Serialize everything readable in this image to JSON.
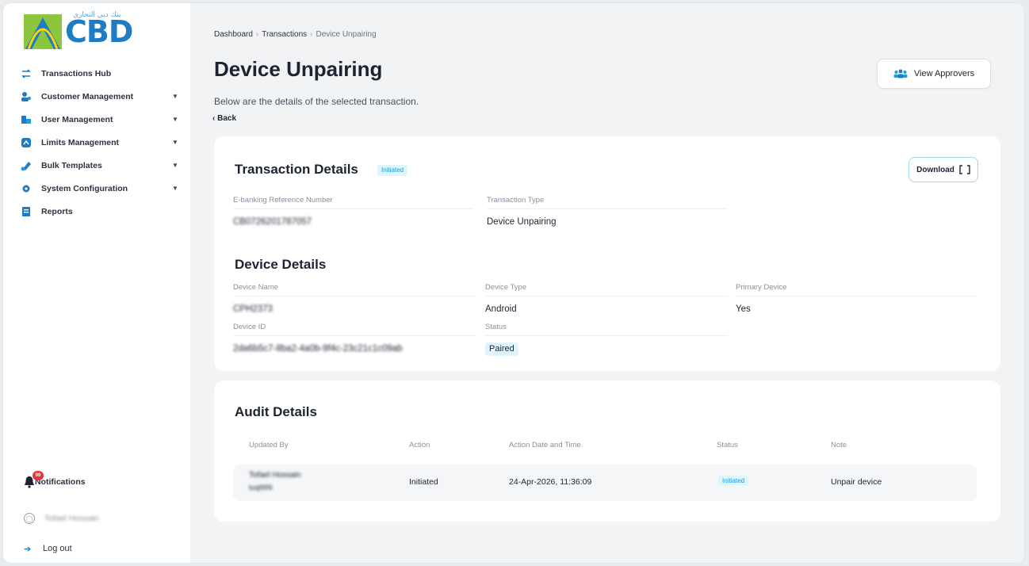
{
  "brand": {
    "arabic_text": "بنك دبي التجاري",
    "wordmark": "CBD"
  },
  "colors": {
    "brand_blue": "#1e7cc4",
    "accent_cyan": "#1a9fd6",
    "badge_bg": "#dff4fc",
    "notification_red": "#e23a3a"
  },
  "sidebar": {
    "items": [
      {
        "label": "Transactions Hub",
        "icon": "transactions-hub-icon",
        "has_caret": false
      },
      {
        "label": "Customer Management",
        "icon": "customer-management-icon",
        "has_caret": true
      },
      {
        "label": "User Management",
        "icon": "user-management-icon",
        "has_caret": true
      },
      {
        "label": "Limits Management",
        "icon": "limits-management-icon",
        "has_caret": true
      },
      {
        "label": "Bulk Templates",
        "icon": "bulk-templates-icon",
        "has_caret": true
      },
      {
        "label": "System Configuration",
        "icon": "system-configuration-icon",
        "has_caret": true
      },
      {
        "label": "Reports",
        "icon": "reports-icon",
        "has_caret": false
      }
    ],
    "notifications_label": "Notifications",
    "notifications_count": "99",
    "user_name": "Tofael Hossain",
    "logout_label": "Log out"
  },
  "breadcrumb": {
    "items": [
      "Dashboard",
      "Transactions",
      "Device Unpairing"
    ],
    "separator": "›"
  },
  "page": {
    "title": "Device Unpairing",
    "subtitle": "Below are the details of the selected transaction.",
    "back_label": "‹ Back",
    "view_approvers_label": "View Approvers"
  },
  "transaction_details": {
    "title": "Transaction Details",
    "status_badge": "Initiated",
    "download_label": "Download",
    "fields": [
      {
        "label": "E-banking Reference Number",
        "value": "CB0726201787057"
      },
      {
        "label": "Transaction Type",
        "value": "Device Unpairing"
      }
    ]
  },
  "device_details": {
    "title": "Device Details",
    "fields": [
      {
        "label": "Device Name",
        "value": "CPH2373"
      },
      {
        "label": "Device Type",
        "value": "Android"
      },
      {
        "label": "Primary Device",
        "value": "Yes"
      },
      {
        "label": "Device ID",
        "value": "2da6b5c7-8ba2-4a0b-9f4c-23c21c1c09ab"
      },
      {
        "label": "Status",
        "value": "Paired"
      }
    ]
  },
  "audit_details": {
    "title": "Audit Details",
    "columns": [
      "Updated By",
      "Action",
      "Action Date and Time",
      "Status",
      "Note"
    ],
    "rows": [
      {
        "updated_by": "Tofael Hossain",
        "updated_by_sub": "tuql999",
        "action": "Initiated",
        "datetime": "24-Apr-2026, 11:36:09",
        "status": "Initiated",
        "note": "Unpair device"
      }
    ]
  }
}
